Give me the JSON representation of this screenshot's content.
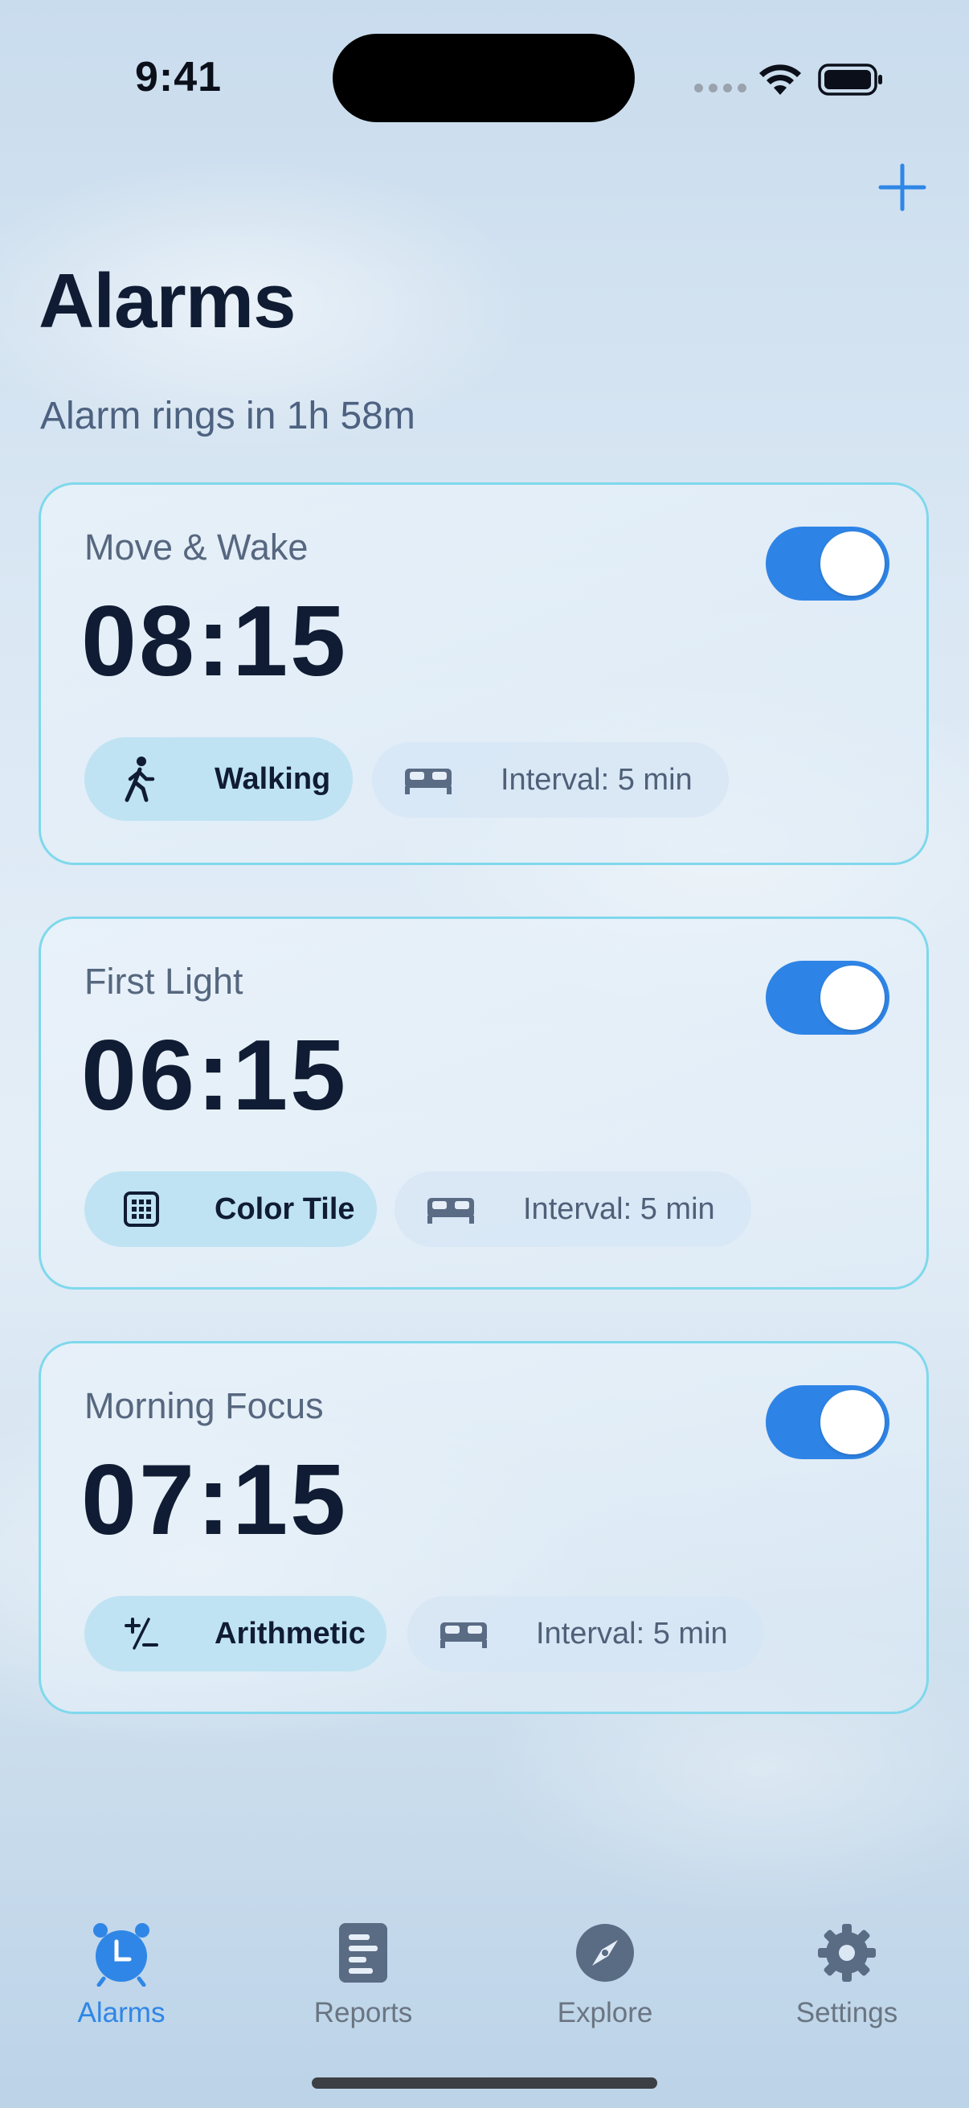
{
  "status_bar": {
    "time": "9:41"
  },
  "header": {
    "title": "Alarms",
    "subtitle": "Alarm rings in 1h 58m",
    "add_icon": "plus-icon"
  },
  "colors": {
    "accent": "#2f86e6",
    "card_border": "#7fd8ec",
    "text_dark": "#101c33",
    "text_muted": "#56677f",
    "mission_chip": "#bfe3f3"
  },
  "alarms": [
    {
      "label": "Move & Wake",
      "time": "08:15",
      "enabled": true,
      "mission": "Walking",
      "mission_icon": "walking-person-icon",
      "snooze_icon": "bed-icon",
      "snooze": "Interval: 5 min"
    },
    {
      "label": "First Light",
      "time": "06:15",
      "enabled": true,
      "mission": "Color Tile",
      "mission_icon": "color-tile-grid-icon",
      "snooze_icon": "bed-icon",
      "snooze": "Interval: 5 min"
    },
    {
      "label": "Morning Focus",
      "time": "07:15",
      "enabled": true,
      "mission": "Arithmetic",
      "mission_icon": "plus-minus-icon",
      "snooze_icon": "bed-icon",
      "snooze": "Interval: 5 min"
    }
  ],
  "tabs": [
    {
      "label": "Alarms",
      "icon": "alarm-clock-icon",
      "active": true
    },
    {
      "label": "Reports",
      "icon": "report-icon",
      "active": false
    },
    {
      "label": "Explore",
      "icon": "compass-icon",
      "active": false
    },
    {
      "label": "Settings",
      "icon": "gear-icon",
      "active": false
    }
  ]
}
